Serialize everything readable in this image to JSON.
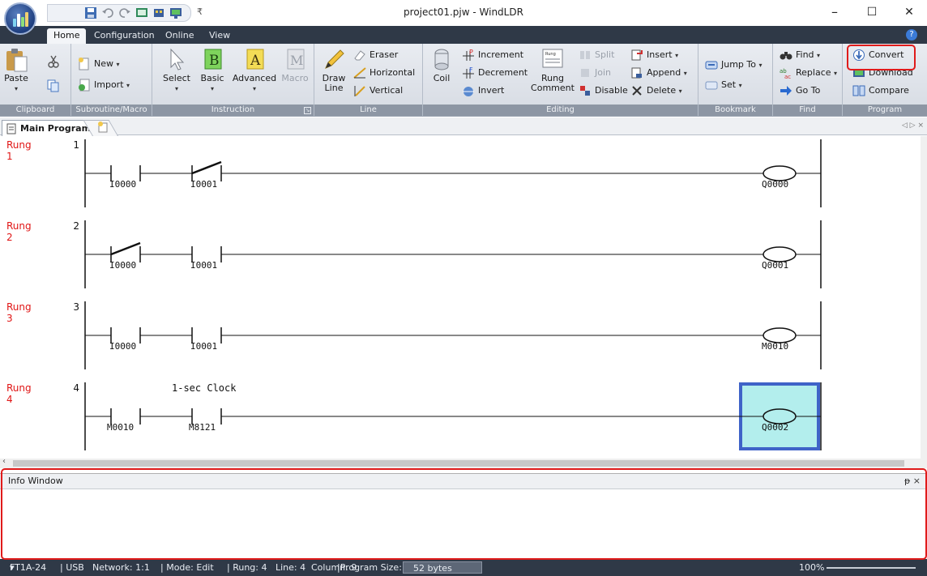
{
  "window": {
    "title": "project01.pjw - WindLDR",
    "minimize": "–",
    "maximize": "☐",
    "close": "✕",
    "qat_more": "₹"
  },
  "ribbon_tabs": [
    "Home",
    "Configuration",
    "Online",
    "View"
  ],
  "ribbon": {
    "clipboard": {
      "paste": "Paste",
      "label": "Clipboard"
    },
    "subroutine": {
      "new": "New",
      "import": "Import",
      "label": "Subroutine/Macro"
    },
    "instruction": {
      "select": "Select",
      "basic": "Basic",
      "advanced": "Advanced",
      "macro": "Macro",
      "label": "Instruction"
    },
    "line": {
      "draw_line_1": "Draw",
      "draw_line_2": "Line",
      "eraser": "Eraser",
      "horizontal": "Horizontal",
      "vertical": "Vertical",
      "label": "Line"
    },
    "editing": {
      "coil": "Coil",
      "increment": "Increment",
      "decrement": "Decrement",
      "invert": "Invert",
      "rung_comment_1": "Rung",
      "rung_comment_2": "Comment",
      "split": "Split",
      "join": "Join",
      "disable": "Disable",
      "insert": "Insert",
      "append": "Append",
      "delete": "Delete",
      "label": "Editing"
    },
    "bookmark": {
      "jump_to": "Jump To",
      "set": "Set",
      "label": "Bookmark"
    },
    "find": {
      "find": "Find",
      "replace": "Replace",
      "go_to": "Go To",
      "label": "Find"
    },
    "program": {
      "convert": "Convert",
      "download": "Download",
      "compare": "Compare",
      "label": "Program"
    }
  },
  "doc_tab": {
    "main": "Main Program",
    "scroll": "◁ ▷ ×"
  },
  "rungs": [
    {
      "label": "Rung",
      "num_below": "1",
      "num": "1",
      "contact1": "I0000",
      "contact2": "I0001",
      "coil": "Q0000",
      "c1_type": "NO",
      "c2_type": "NC"
    },
    {
      "label": "Rung",
      "num_below": "2",
      "num": "2",
      "contact1": "I0000",
      "contact2": "I0001",
      "coil": "Q0001",
      "c1_type": "NC",
      "c2_type": "NO"
    },
    {
      "label": "Rung",
      "num_below": "3",
      "num": "3",
      "contact1": "I0000",
      "contact2": "I0001",
      "coil": "M0010",
      "c1_type": "NO",
      "c2_type": "NO"
    },
    {
      "label": "Rung",
      "num_below": "4",
      "num": "4",
      "comment": "1-sec Clock",
      "contact1": "M0010",
      "contact2": "M8121",
      "coil": "Q0002",
      "c1_type": "NO",
      "c2_type": "NO"
    }
  ],
  "info_window": {
    "title": "Info Window",
    "pin": "ᵽ ×"
  },
  "status_bar": {
    "plc_model": "FT1A-24",
    "model_caret": "▾",
    "connection": "| USB",
    "network": "Network: 1:1",
    "mode": "| Mode: Edit",
    "rung": "| Rung: 4",
    "line": "Line: 4",
    "column": "Column: 9",
    "program_size_label": "|Program Size:",
    "program_size_value": "52 bytes",
    "zoom": "100%"
  },
  "colors": {
    "rung_label": "#e01515",
    "cursor_fill": "#b3eeed",
    "cursor_border": "#3f63c8",
    "highlight": "#e01b1b",
    "status_bg": "#2f3947"
  }
}
